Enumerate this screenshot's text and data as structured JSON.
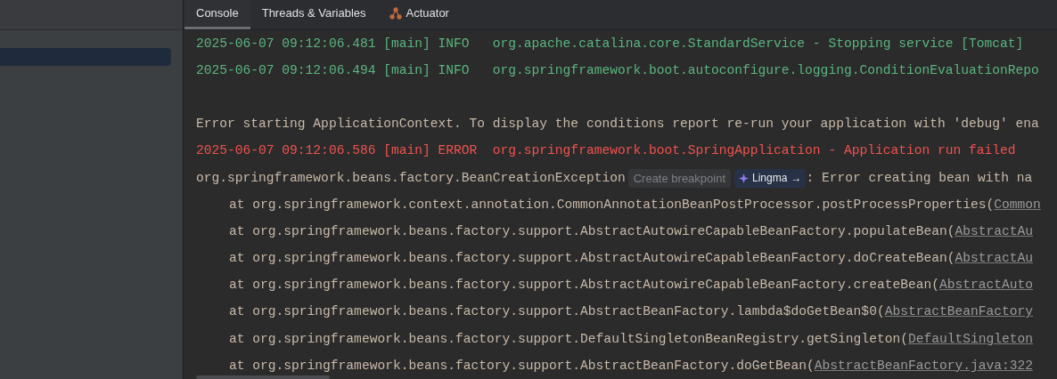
{
  "sidebar": {
    "rows": [
      {
        "selected": false
      },
      {
        "selected": true
      }
    ]
  },
  "tabs": [
    {
      "label": "Console",
      "selected": true,
      "kind": "plain"
    },
    {
      "label": "Threads & Variables",
      "selected": false,
      "kind": "plain"
    },
    {
      "label": "Actuator",
      "selected": false,
      "kind": "actuator"
    }
  ],
  "console": {
    "lines": [
      {
        "kind": "info",
        "head": "2025-06-07 09:12:06.481 [main] INFO   ",
        "text": "org.apache.catalina.core.StandardService - Stopping service [Tomcat]"
      },
      {
        "kind": "info",
        "head": "2025-06-07 09:12:06.494 [main] INFO   ",
        "text": "org.springframework.boot.autoconfigure.logging.ConditionEvaluationRepo"
      },
      {
        "kind": "blank"
      },
      {
        "kind": "text",
        "text": "Error starting ApplicationContext. To display the conditions report re-run your application with 'debug' ena"
      },
      {
        "kind": "error",
        "head": "2025-06-07 09:12:06.586 [main] ERROR  ",
        "text": "org.springframework.boot.SpringApplication - Application run failed"
      },
      {
        "kind": "exception",
        "text": "org.springframework.beans.factory.BeanCreationException",
        "hint": "Create breakpoint",
        "badge": "Lingma",
        "arrow": "→",
        "rest": ": Error creating bean with na"
      },
      {
        "kind": "stack",
        "text": "at org.springframework.context.annotation.CommonAnnotationBeanPostProcessor.postProcessProperties(",
        "link": "Common"
      },
      {
        "kind": "stack",
        "text": "at org.springframework.beans.factory.support.AbstractAutowireCapableBeanFactory.populateBean(",
        "link": "AbstractAu"
      },
      {
        "kind": "stack",
        "text": "at org.springframework.beans.factory.support.AbstractAutowireCapableBeanFactory.doCreateBean(",
        "link": "AbstractAu"
      },
      {
        "kind": "stack",
        "text": "at org.springframework.beans.factory.support.AbstractAutowireCapableBeanFactory.createBean(",
        "link": "AbstractAuto"
      },
      {
        "kind": "stack",
        "text": "at org.springframework.beans.factory.support.AbstractBeanFactory.lambda$doGetBean$0(",
        "link": "AbstractBeanFactory"
      },
      {
        "kind": "stack",
        "text": "at org.springframework.beans.factory.support.DefaultSingletonBeanRegistry.getSingleton(",
        "link": "DefaultSingleton"
      },
      {
        "kind": "stack",
        "text": "at org.springframework.beans.factory.support.AbstractBeanFactory.doGetBean(",
        "link": "AbstractBeanFactory.java:322"
      }
    ]
  }
}
